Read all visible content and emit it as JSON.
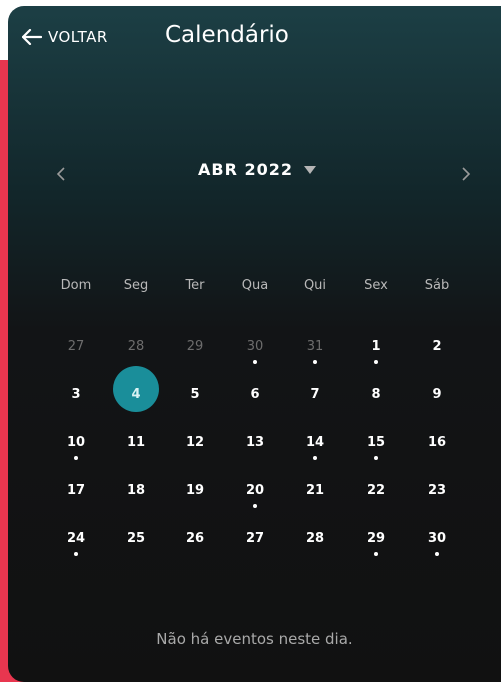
{
  "header": {
    "back_label": "VOLTAR",
    "title": "Calendário"
  },
  "calendar": {
    "month_label": "ABR 2022",
    "weekdays": [
      "Dom",
      "Seg",
      "Ter",
      "Qua",
      "Qui",
      "Sex",
      "Sáb"
    ],
    "weeks": [
      [
        {
          "d": "27",
          "muted": true
        },
        {
          "d": "28",
          "muted": true
        },
        {
          "d": "29",
          "muted": true
        },
        {
          "d": "30",
          "muted": true,
          "dot": true
        },
        {
          "d": "31",
          "muted": true,
          "dot": true
        },
        {
          "d": "1",
          "dot": true
        },
        {
          "d": "2"
        }
      ],
      [
        {
          "d": "3"
        },
        {
          "d": "4",
          "selected": true
        },
        {
          "d": "5"
        },
        {
          "d": "6"
        },
        {
          "d": "7"
        },
        {
          "d": "8"
        },
        {
          "d": "9"
        }
      ],
      [
        {
          "d": "10",
          "dot": true
        },
        {
          "d": "11"
        },
        {
          "d": "12"
        },
        {
          "d": "13"
        },
        {
          "d": "14",
          "dot": true
        },
        {
          "d": "15",
          "dot": true
        },
        {
          "d": "16"
        }
      ],
      [
        {
          "d": "17"
        },
        {
          "d": "18"
        },
        {
          "d": "19"
        },
        {
          "d": "20",
          "dot": true
        },
        {
          "d": "21"
        },
        {
          "d": "22"
        },
        {
          "d": "23"
        }
      ],
      [
        {
          "d": "24",
          "dot": true
        },
        {
          "d": "25"
        },
        {
          "d": "26"
        },
        {
          "d": "27"
        },
        {
          "d": "28"
        },
        {
          "d": "29",
          "dot": true
        },
        {
          "d": "30",
          "dot": true
        }
      ]
    ],
    "empty_message": "Não há eventos neste dia."
  },
  "colors": {
    "accent_bar": "#e8364f",
    "selected_day": "#1a8e9a",
    "background": "#111111"
  },
  "icons": {
    "back": "arrow-left-icon",
    "prev": "chevron-left-icon",
    "next": "chevron-right-icon",
    "dropdown": "caret-down-icon"
  }
}
